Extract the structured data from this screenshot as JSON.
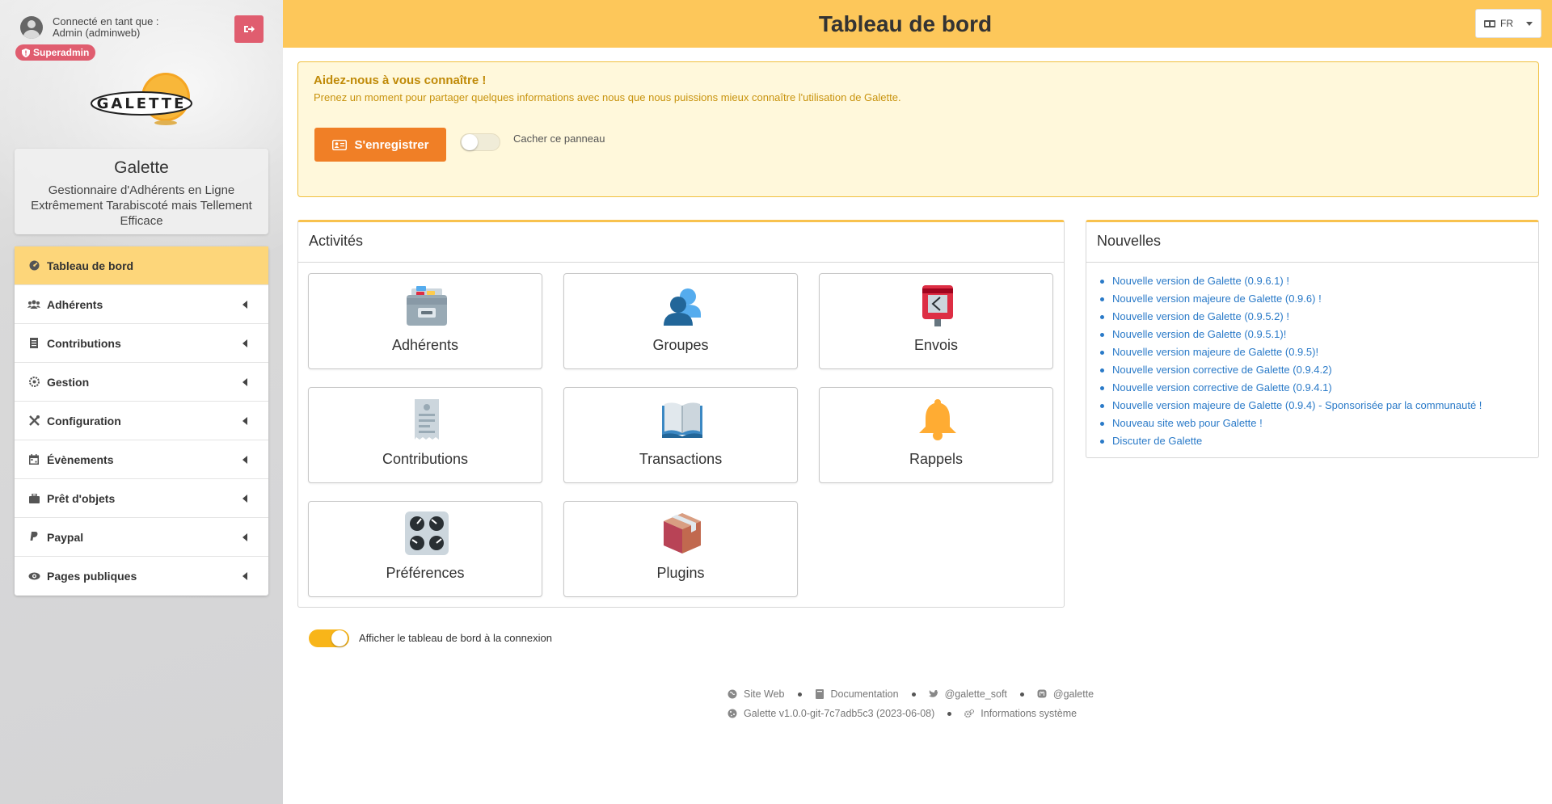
{
  "user": {
    "connected_label": "Connecté en tant que :",
    "name": "Admin (adminweb)",
    "role_badge": "Superadmin"
  },
  "brand": {
    "title": "Galette",
    "subtitle": "Gestionnaire d'Adhérents en Ligne Extrêmement Tarabiscoté mais Tellement Efficace"
  },
  "menu": [
    {
      "label": "Tableau de bord",
      "icon": "dashboard-icon",
      "active": true
    },
    {
      "label": "Adhérents",
      "icon": "users-icon"
    },
    {
      "label": "Contributions",
      "icon": "receipt-icon"
    },
    {
      "label": "Gestion",
      "icon": "cog-icon"
    },
    {
      "label": "Configuration",
      "icon": "tools-icon"
    },
    {
      "label": "Évènements",
      "icon": "calendar-icon"
    },
    {
      "label": "Prêt d'objets",
      "icon": "briefcase-icon"
    },
    {
      "label": "Paypal",
      "icon": "paypal-icon"
    },
    {
      "label": "Pages publiques",
      "icon": "eye-icon"
    }
  ],
  "header": {
    "title": "Tableau de bord",
    "language": "FR"
  },
  "info_panel": {
    "title": "Aidez-nous à vous connaître !",
    "text": "Prenez un moment pour partager quelques informations avec nous que nous puissions mieux connaître l'utilisation de Galette.",
    "register_label": "S'enregistrer",
    "hide_label": "Cacher ce panneau"
  },
  "activities": {
    "title": "Activités",
    "tiles": [
      {
        "label": "Adhérents",
        "icon": "card-index-icon"
      },
      {
        "label": "Groupes",
        "icon": "groups-icon"
      },
      {
        "label": "Envois",
        "icon": "postbox-icon"
      },
      {
        "label": "Contributions",
        "icon": "receipt-icon"
      },
      {
        "label": "Transactions",
        "icon": "open-book-icon"
      },
      {
        "label": "Rappels",
        "icon": "bell-icon"
      },
      {
        "label": "Préférences",
        "icon": "control-knobs-icon"
      },
      {
        "label": "Plugins",
        "icon": "package-icon"
      }
    ]
  },
  "news": {
    "title": "Nouvelles",
    "items": [
      "Nouvelle version de Galette (0.9.6.1) !",
      "Nouvelle version majeure de Galette (0.9.6) !",
      "Nouvelle version de Galette (0.9.5.2) !",
      "Nouvelle version de Galette (0.9.5.1)!",
      "Nouvelle version majeure de Galette (0.9.5)!",
      "Nouvelle version corrective de Galette (0.9.4.2)",
      "Nouvelle version corrective de Galette (0.9.4.1)",
      "Nouvelle version majeure de Galette (0.9.4) - Sponsorisée par la communauté !",
      "Nouveau site web pour Galette !",
      "Discuter de Galette"
    ]
  },
  "dashboard_toggle": {
    "label": "Afficher le tableau de bord à la connexion",
    "on": true
  },
  "footer": {
    "website": "Site Web",
    "documentation": "Documentation",
    "twitter": "@galette_soft",
    "mastodon": "@galette",
    "version": "Galette v1.0.0-git-7c7adb5c3 (2023-06-08)",
    "system_info": "Informations système"
  },
  "colors": {
    "header_bg": "#fdc75a",
    "active_menu": "#fdd67a",
    "register_button": "#f07f26",
    "logout_button": "#e05d6f",
    "link": "#2a7ac8"
  }
}
